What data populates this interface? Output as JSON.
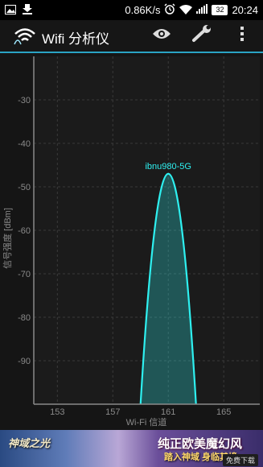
{
  "status_bar": {
    "icons_left": [
      "image-notification-icon",
      "download-icon"
    ],
    "net_speed": "0.86K/s",
    "icons_right": [
      "alarm-icon",
      "wifi-signal-icon",
      "cell-signal-icon"
    ],
    "battery": "32",
    "time": "20:24"
  },
  "action_bar": {
    "title": "Wifi 分析仪",
    "icons": [
      "eye-icon",
      "wrench-icon",
      "overflow-menu-icon"
    ],
    "accent_color": "#2aa3c4"
  },
  "chart_data": {
    "type": "area",
    "ylabel": "信号强度 [dBm]",
    "xlabel": "Wi-Fi 信道",
    "ylim": [
      -100,
      -20
    ],
    "xlim": [
      151.3,
      167.6
    ],
    "yticks": [
      -30,
      -40,
      -50,
      -60,
      -70,
      -80,
      -90
    ],
    "xticks": [
      153,
      157,
      161,
      165
    ],
    "grid": true,
    "series": [
      {
        "name": "ibnu980-5G",
        "channel": 161,
        "x": [
          159,
          161,
          163
        ],
        "y": [
          -100,
          -47,
          -100
        ],
        "color": "#2ef0f0"
      }
    ]
  },
  "ad": {
    "game_title": "神域之光",
    "headline": "纯正欧美魔幻风",
    "subline": "踏入神域 身临其境",
    "download_label": "免费下载"
  }
}
